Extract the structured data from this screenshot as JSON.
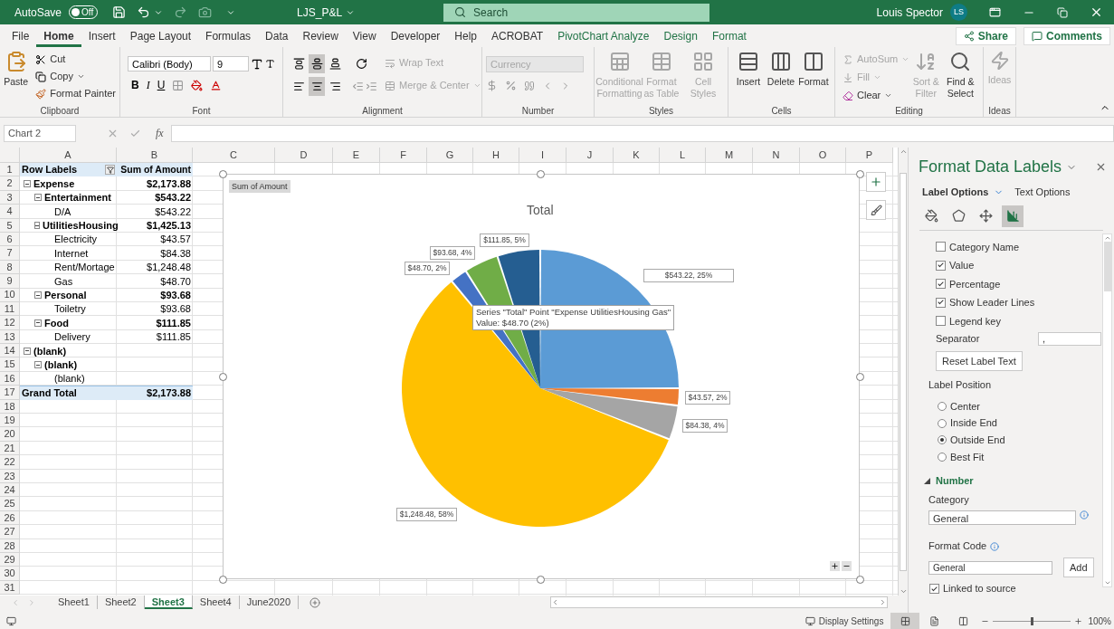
{
  "title_bar": {
    "autosave": {
      "label": "AutoSave",
      "state": "Off",
      "on": false
    },
    "file_name": "LJS_P&L",
    "search": {
      "placeholder": "Search"
    },
    "user": {
      "name": "Louis Spector",
      "initials": "LS"
    }
  },
  "menu_tabs": [
    {
      "label": "File",
      "selected": false,
      "contextual": false
    },
    {
      "label": "Home",
      "selected": true,
      "contextual": false
    },
    {
      "label": "Insert",
      "selected": false,
      "contextual": false
    },
    {
      "label": "Page Layout",
      "selected": false,
      "contextual": false
    },
    {
      "label": "Formulas",
      "selected": false,
      "contextual": false
    },
    {
      "label": "Data",
      "selected": false,
      "contextual": false
    },
    {
      "label": "Review",
      "selected": false,
      "contextual": false
    },
    {
      "label": "View",
      "selected": false,
      "contextual": false
    },
    {
      "label": "Developer",
      "selected": false,
      "contextual": false
    },
    {
      "label": "Help",
      "selected": false,
      "contextual": false
    },
    {
      "label": "ACROBAT",
      "selected": false,
      "contextual": false
    },
    {
      "label": "PivotChart Analyze",
      "selected": false,
      "contextual": true
    },
    {
      "label": "Design",
      "selected": false,
      "contextual": true
    },
    {
      "label": "Format",
      "selected": false,
      "contextual": true
    }
  ],
  "share": "Share",
  "comments": "Comments",
  "ribbon": {
    "clipboard": {
      "title": "Clipboard",
      "paste": "Paste",
      "cut": "Cut",
      "copy": "Copy",
      "format_painter": "Format Painter"
    },
    "font": {
      "title": "Font",
      "font_name": "Calibri (Body)",
      "font_size": "9",
      "bold": "B",
      "italic": "I",
      "underline": "U"
    },
    "alignment": {
      "title": "Alignment",
      "vertical_align": [
        {
          "selected": false
        },
        {
          "selected": true
        },
        {
          "selected": false
        }
      ],
      "horizontal_align": [
        {
          "selected": false
        },
        {
          "selected": true
        },
        {
          "selected": false
        }
      ],
      "wrap_text": {
        "label": "Wrap Text",
        "disabled": true
      },
      "merge_center": {
        "label": "Merge & Center",
        "disabled": true
      }
    },
    "number": {
      "title": "Number",
      "format": {
        "value": "Currency",
        "disabled": true
      }
    },
    "styles": {
      "title": "Styles",
      "items": [
        {
          "label": "Conditional Formatting",
          "disabled": true
        },
        {
          "label": "Format as Table",
          "disabled": true
        },
        {
          "label": "Cell Styles",
          "disabled": true
        }
      ]
    },
    "cells": {
      "title": "Cells",
      "items": [
        {
          "label": "Insert",
          "disabled": false
        },
        {
          "label": "Delete",
          "disabled": false
        },
        {
          "label": "Format",
          "disabled": false
        }
      ]
    },
    "editing": {
      "title": "Editing",
      "autosum": {
        "label": "AutoSum",
        "disabled": true
      },
      "fill": {
        "label": "Fill",
        "disabled": true
      },
      "clear": {
        "label": "Clear",
        "disabled": false
      },
      "sort_filter": {
        "label": "Sort & Filter",
        "disabled": true
      },
      "find_select": {
        "label": "Find & Select",
        "disabled": false
      }
    },
    "ideas": {
      "title": "Ideas",
      "button": {
        "label": "Ideas",
        "disabled": true
      }
    }
  },
  "formula_bar": {
    "name_box": "Chart 2",
    "function_label": "fx"
  },
  "grid": {
    "columns": [
      "A",
      "B",
      "C",
      "D",
      "E",
      "F",
      "G",
      "H",
      "I",
      "J",
      "K",
      "L",
      "M",
      "N",
      "O",
      "P"
    ],
    "row_numbers": [
      "1",
      "2",
      "3",
      "4",
      "5",
      "6",
      "7",
      "8",
      "9",
      "10",
      "11",
      "12",
      "13",
      "14",
      "15",
      "16",
      "17",
      "18",
      "19",
      "20",
      "21",
      "22",
      "23",
      "24",
      "25",
      "26",
      "27",
      "28",
      "29",
      "30",
      "31"
    ]
  },
  "pivot": {
    "header": {
      "row_labels": "Row Labels",
      "values": "Sum of Amount"
    },
    "rows": [
      {
        "label": "Expense",
        "amount": "$2,173.88",
        "expanded": true,
        "children": [
          {
            "label": "Entertainment",
            "amount": "$543.22",
            "expanded": true,
            "children": [
              {
                "label": "D/A",
                "amount": "$543.22"
              }
            ]
          },
          {
            "label": "UtilitiesHousing",
            "amount": "$1,425.13",
            "expanded": true,
            "children": [
              {
                "label": "Electricity",
                "amount": "$43.57"
              },
              {
                "label": "Internet",
                "amount": "$84.38"
              },
              {
                "label": "Rent/Mortage",
                "amount": "$1,248.48"
              },
              {
                "label": "Gas",
                "amount": "$48.70"
              }
            ]
          },
          {
            "label": "Personal",
            "amount": "$93.68",
            "expanded": true,
            "children": [
              {
                "label": "Toiletry",
                "amount": "$93.68"
              }
            ]
          },
          {
            "label": "Food",
            "amount": "$111.85",
            "expanded": true,
            "children": [
              {
                "label": "Delivery",
                "amount": "$111.85"
              }
            ]
          }
        ]
      },
      {
        "label": "(blank)",
        "expanded": true,
        "children": [
          {
            "label": "(blank)",
            "expanded": true,
            "children": [
              {
                "label": "(blank)"
              }
            ]
          }
        ]
      }
    ],
    "grand_total": {
      "label": "Grand Total",
      "amount": "$2,173.88"
    }
  },
  "chart": {
    "field_button": "Sum of Amount",
    "chart_data": {
      "type": "pie",
      "title": "Total",
      "values": [
        25,
        2,
        4,
        58,
        2,
        4,
        5
      ],
      "colors": [
        "#5b9bd5",
        "#ed7d31",
        "#a5a5a5",
        "#ffc000",
        "#4472c4",
        "#70ad47",
        "#255e91"
      ],
      "value_labels": [
        "$543.22, 25%",
        "$43.57, 2%",
        "$84.38, 4%",
        "$1,248.48, 58%",
        "$48.70, 2%",
        "$93.68, 4%",
        "$111.85, 5%"
      ]
    },
    "tooltip": [
      "Series \"Total\" Point \"Expense UtilitiesHousing Gas\"",
      "Value: $48.70 (2%)"
    ]
  },
  "sheet_tabs": [
    {
      "label": "Sheet1",
      "selected": false
    },
    {
      "label": "Sheet2",
      "selected": false
    },
    {
      "label": "Sheet3",
      "selected": true
    },
    {
      "label": "Sheet4",
      "selected": false
    },
    {
      "label": "June2020",
      "selected": false
    }
  ],
  "format_panel": {
    "title": "Format Data Labels",
    "tabs": [
      {
        "label": "Label Options",
        "selected": true
      },
      {
        "label": "Text Options",
        "selected": false
      }
    ],
    "icon_tabs": [
      {
        "selected": false
      },
      {
        "selected": false
      },
      {
        "selected": false
      },
      {
        "selected": true
      }
    ],
    "label_contains": [
      {
        "label": "Category Name",
        "checked": false
      },
      {
        "label": "Value",
        "checked": true
      },
      {
        "label": "Percentage",
        "checked": true
      },
      {
        "label": "Show Leader Lines",
        "checked": true
      },
      {
        "label": "Legend key",
        "checked": false
      }
    ],
    "separator": {
      "label": "Separator",
      "value": ","
    },
    "reset_button": "Reset Label Text",
    "label_position": {
      "title": "Label Position",
      "options": [
        {
          "label": "Center",
          "selected": false
        },
        {
          "label": "Inside End",
          "selected": false
        },
        {
          "label": "Outside End",
          "selected": true
        },
        {
          "label": "Best Fit",
          "selected": false
        }
      ]
    },
    "number": {
      "title": "Number",
      "expanded": true,
      "category_label": "Category",
      "category_value": "General",
      "format_code_label": "Format Code",
      "format_code_value": "General",
      "add_button": "Add",
      "linked": {
        "label": "Linked to source",
        "checked": true
      }
    }
  },
  "status_bar": {
    "display_settings": "Display Settings",
    "views": [
      {
        "selected": true
      },
      {
        "selected": false
      },
      {
        "selected": false
      }
    ],
    "zoom": {
      "level": 0.5,
      "reading": "100%"
    }
  }
}
